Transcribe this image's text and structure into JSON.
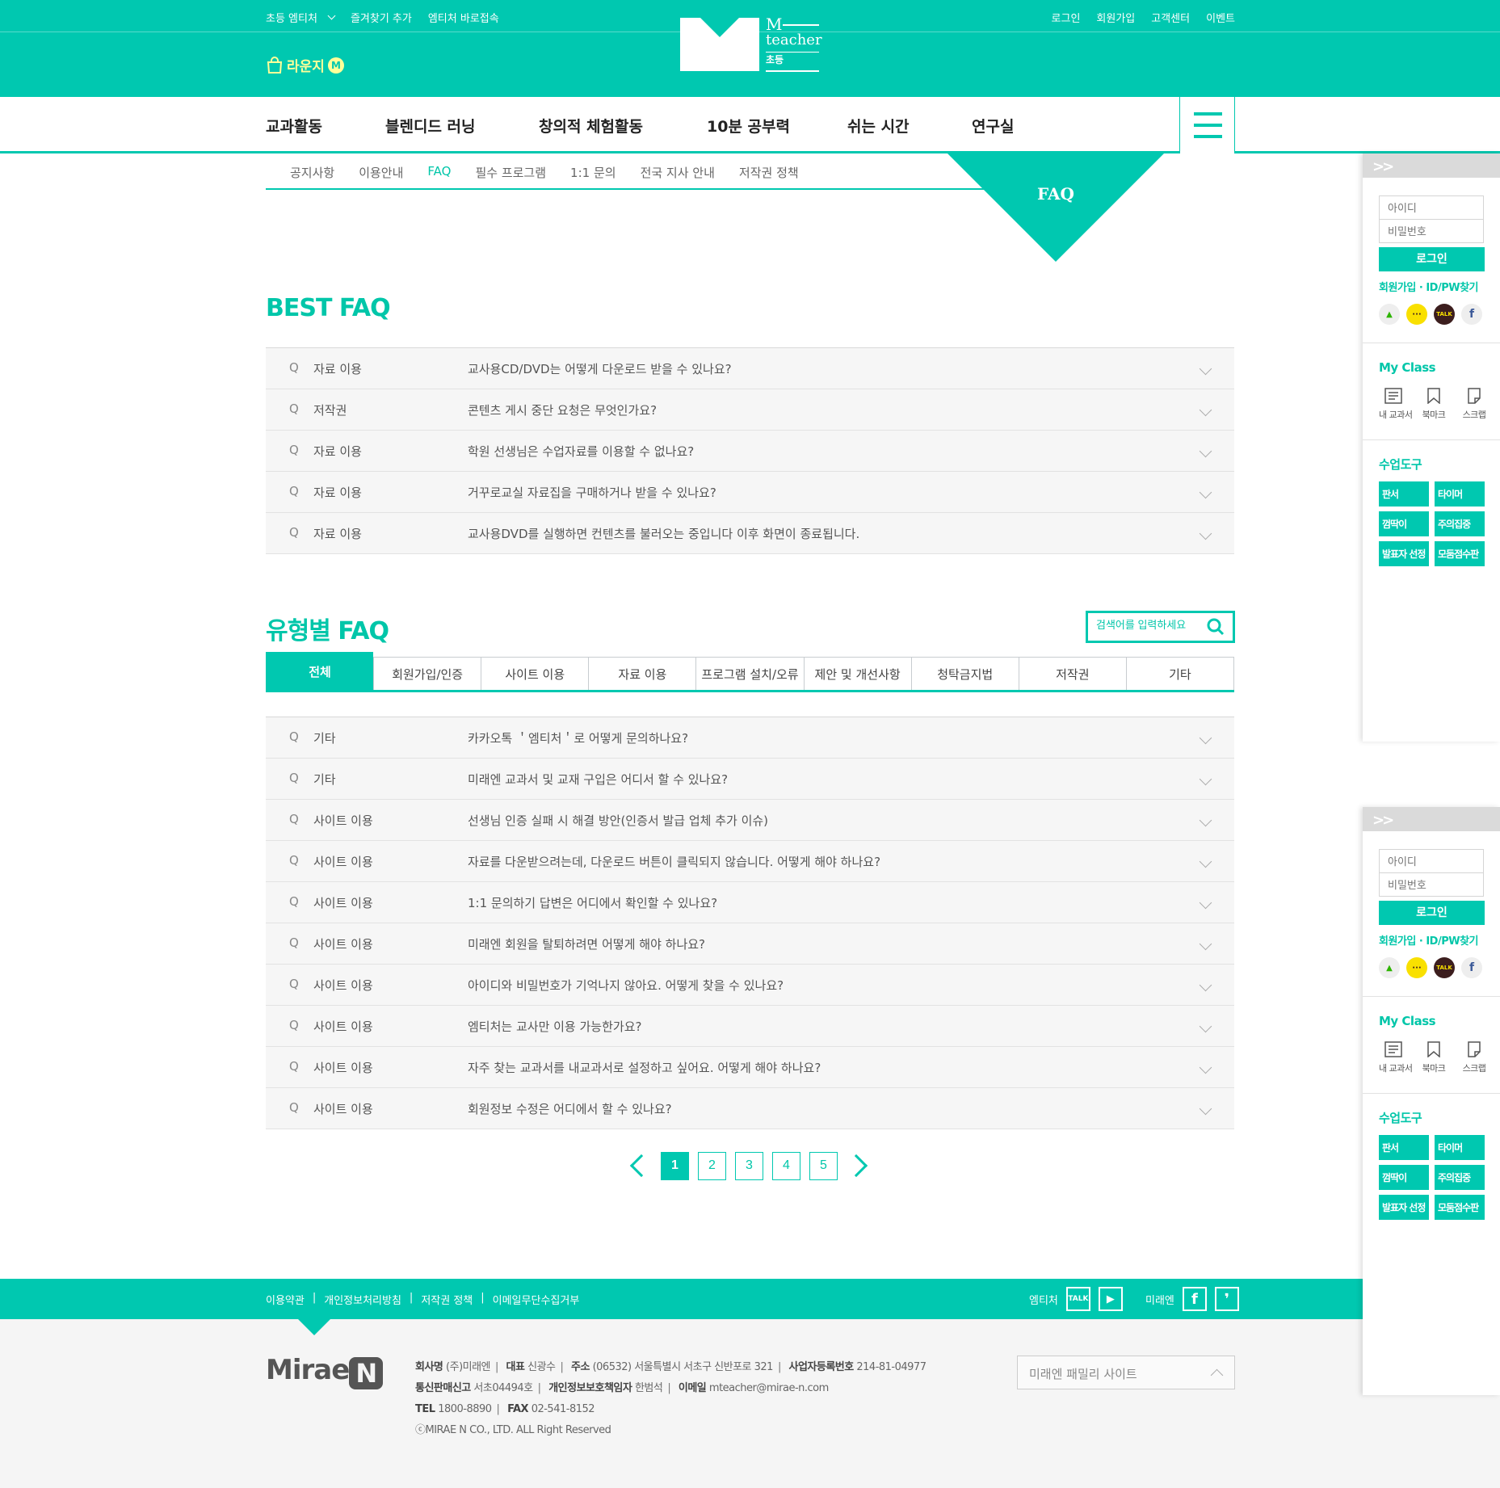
{
  "header": {
    "util_left": [
      "초등 엠티처",
      "즐겨찾기 추가",
      "엠티처 바로접속"
    ],
    "util_right": [
      "로그인",
      "회원가입",
      "고객센터",
      "이벤트"
    ],
    "lounge_label": "라운지",
    "lounge_badge": "M",
    "logo": {
      "line1": "M",
      "line2": "teacher",
      "line3": "초등"
    }
  },
  "gnb": {
    "items": [
      "교과활동",
      "블렌디드 러닝",
      "창의적 체험활동",
      "10분 공부력",
      "쉬는 시간",
      "연구실"
    ]
  },
  "subnav": {
    "items": [
      "공지사항",
      "이용안내",
      "FAQ",
      "필수 프로그램",
      "1:1 문의",
      "전국 지사 안내",
      "저작권 정책"
    ],
    "active_index": 2,
    "badge": "FAQ"
  },
  "best_faq": {
    "title": "BEST FAQ",
    "rows": [
      {
        "q": "Q",
        "category": "자료 이용",
        "question": "교사용CD/DVD는 어떻게 다운로드 받을 수 있나요?"
      },
      {
        "q": "Q",
        "category": "저작권",
        "question": "콘텐츠 게시 중단 요청은 무엇인가요?"
      },
      {
        "q": "Q",
        "category": "자료 이용",
        "question": "학원 선생님은 수업자료를 이용할 수 없나요?"
      },
      {
        "q": "Q",
        "category": "자료 이용",
        "question": "거꾸로교실 자료집을 구매하거나 받을 수 있나요?"
      },
      {
        "q": "Q",
        "category": "자료 이용",
        "question": "교사용DVD를 실행하면 컨텐츠를 불러오는 중입니다 이후 화면이 종료됩니다."
      }
    ]
  },
  "type_faq": {
    "title": "유형별 FAQ",
    "search_placeholder": "검색어를 입력하세요",
    "tabs": [
      "전체",
      "회원가입/인증",
      "사이트 이용",
      "자료 이용",
      "프로그램 설치/오류",
      "제안 및 개선사항",
      "청탁금지법",
      "저작권",
      "기타"
    ],
    "active_tab": 0,
    "rows": [
      {
        "q": "Q",
        "category": "기타",
        "question": "카카오톡 ＇엠티처＇로 어떻게 문의하나요?"
      },
      {
        "q": "Q",
        "category": "기타",
        "question": "미래엔 교과서 및 교재 구입은 어디서 할 수 있나요?"
      },
      {
        "q": "Q",
        "category": "사이트 이용",
        "question": "선생님 인증 실패 시 해결 방안(인증서 발급 업체 추가 이슈)"
      },
      {
        "q": "Q",
        "category": "사이트 이용",
        "question": "자료를 다운받으려는데, 다운로드 버튼이 클릭되지 않습니다. 어떻게 해야 하나요?"
      },
      {
        "q": "Q",
        "category": "사이트 이용",
        "question": "1:1 문의하기 답변은 어디에서 확인할 수 있나요?"
      },
      {
        "q": "Q",
        "category": "사이트 이용",
        "question": "미래엔 회원을 탈퇴하려면 어떻게 해야 하나요?"
      },
      {
        "q": "Q",
        "category": "사이트 이용",
        "question": "아이디와 비밀번호가 기억나지 않아요. 어떻게 찾을 수 있나요?"
      },
      {
        "q": "Q",
        "category": "사이트 이용",
        "question": "엠티처는 교사만 이용 가능한가요?"
      },
      {
        "q": "Q",
        "category": "사이트 이용",
        "question": "자주 찾는 교과서를 내교과서로 설정하고 싶어요. 어떻게 해야 하나요?"
      },
      {
        "q": "Q",
        "category": "사이트 이용",
        "question": "회원정보 수정은 어디에서 할 수 있나요?"
      }
    ]
  },
  "pagination": {
    "pages": [
      "1",
      "2",
      "3",
      "4",
      "5"
    ],
    "current": 1
  },
  "footer": {
    "links": [
      "이용약관",
      "개인정보처리방침",
      "저작권 정책",
      "이메일무단수집거부"
    ],
    "sns_mteacher_label": "엠티처",
    "sns_miraen_label": "미래엔",
    "sns_icons": [
      "talk-icon",
      "play-icon",
      "facebook-icon",
      "blog-icon"
    ],
    "logo_text": "Mirae",
    "logo_n": "N",
    "info": {
      "company_label": "회사명",
      "company": "(주)미래엔",
      "ceo_label": "대표",
      "ceo": "신광수",
      "addr_label": "주소",
      "addr": "(06532) 서울특별시 서초구 신반포로 321",
      "biz_label": "사업자등록번호",
      "biz": "214-81-04977",
      "mail_order_label": "통신판매신고",
      "mail_order": "서초04494호",
      "privacy_label": "개인정보보호책임자",
      "privacy": "한범석",
      "email_label": "이메일",
      "email": "mteacher@mirae-n.com",
      "tel_label": "TEL",
      "tel": "1800-8890",
      "fax_label": "FAX",
      "fax": "02-541-8152",
      "copyright": "ⓒMIRAE N CO., LTD. ALL Right Reserved"
    },
    "family_site": "미래엔 패밀리 사이트"
  },
  "quick_panel": {
    "id_placeholder": "아이디",
    "pw_placeholder": "비밀번호",
    "login": "로그인",
    "join": "회원가입 · ID/PW찾기",
    "myclass_title": "My Class",
    "myclass_items": [
      "내 교과서",
      "북마크",
      "스크랩"
    ],
    "tools_title": "수업도구",
    "tools": [
      "판서",
      "타이머",
      "껌딱이",
      "주의집중",
      "발표자 선정",
      "모둠점수판"
    ]
  },
  "colors": {
    "accent": "#00c8b0",
    "accent_text": "#00c6a9",
    "lounge": "#ffff99"
  }
}
